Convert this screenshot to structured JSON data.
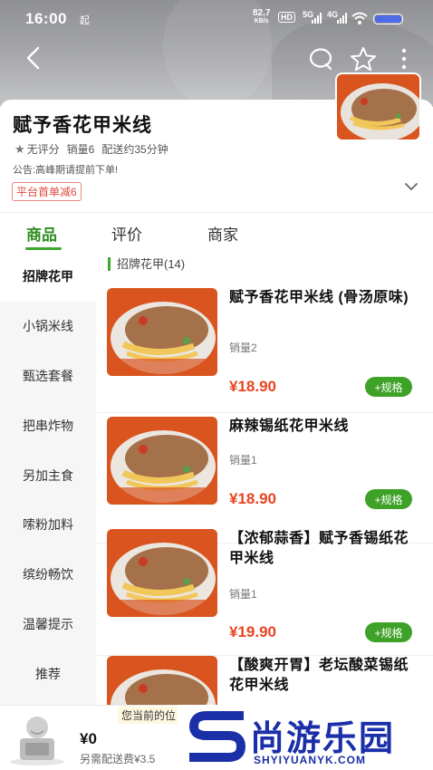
{
  "status_bar": {
    "time": "16:00",
    "extra": "起",
    "speed_value": "82.7",
    "speed_unit": "KB/s",
    "hd": "HD",
    "net1": "5G",
    "net2": "4G"
  },
  "header": {
    "back_icon": "back-arrow-icon",
    "search_icon": "search-icon",
    "favorite_icon": "star-icon",
    "more_icon": "more-vertical-icon"
  },
  "shop": {
    "name": "赋予香花甲米线",
    "rating": "无评分",
    "sales": "销量6",
    "delivery_time": "配送约35分钟",
    "notice": "公告:高峰期请提前下单!",
    "promo": "平台首单减6"
  },
  "tabs": [
    {
      "label": "商品",
      "active": true
    },
    {
      "label": "评价",
      "active": false
    },
    {
      "label": "商家",
      "active": false
    }
  ],
  "sidebar": {
    "items": [
      {
        "label": "招牌花甲",
        "active": true
      },
      {
        "label": "小锅米线",
        "active": false
      },
      {
        "label": "甄选套餐",
        "active": false
      },
      {
        "label": "把串炸物",
        "active": false
      },
      {
        "label": "另加主食",
        "active": false
      },
      {
        "label": "嗦粉加料",
        "active": false
      },
      {
        "label": "缤纷畅饮",
        "active": false
      },
      {
        "label": "温馨提示",
        "active": false
      },
      {
        "label": "推荐",
        "active": false
      }
    ]
  },
  "section": {
    "title": "招牌花甲(14)"
  },
  "products": [
    {
      "name": "赋予香花甲米线 (骨汤原味)",
      "sales": "销量2",
      "price": "¥18.90",
      "button": "+规格"
    },
    {
      "name": "麻辣锡纸花甲米线",
      "sales": "销量1",
      "price": "¥18.90",
      "button": "+规格"
    },
    {
      "name": "【浓郁蒜香】赋予香锡纸花甲米线",
      "sales": "销量1",
      "price": "¥19.90",
      "button": "+规格"
    },
    {
      "name": "【酸爽开胃】老坛酸菜锡纸花甲米线",
      "sales": "",
      "price": "",
      "button": ""
    }
  ],
  "cart": {
    "location_tip": "您当前的位",
    "total": "¥0",
    "delivery": "另需配送费¥3.5"
  },
  "watermark": {
    "main": "尚游乐园",
    "sub": "SHYIYUANYK.COM"
  },
  "colors": {
    "accent_green": "#3aa82a",
    "price_red": "#e8431f",
    "watermark_blue": "#1b2fa8"
  }
}
